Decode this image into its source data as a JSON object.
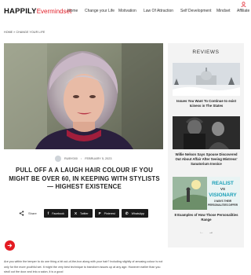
{
  "header": {
    "logo_part1": "HAPPILY",
    "logo_part2": "Evermindset",
    "nav": [
      "Home",
      "Change your Life",
      "Motivation",
      "Law Of Attraction",
      "Self Development",
      "Mindset",
      "Affiliate"
    ]
  },
  "breadcrumb": "HOME » CHANGE YOUR LIFE",
  "article": {
    "author": "RUBY000",
    "date": "FEBRUARY 5, 2023",
    "title": "PULL OFF A A LAUGH HAIR COLOUR IF YOU MIGHT BE OVER 60, IN KEEPING WITH STYLISTS — HIGHEST EXISTENCE",
    "share_label": "Share",
    "share_buttons": [
      {
        "label": "Facebook",
        "glyph": "f"
      },
      {
        "label": "Twitter",
        "glyph": "X"
      },
      {
        "label": "Pinterest",
        "glyph": "P"
      },
      {
        "label": "WhatsApp",
        "glyph": "✆"
      }
    ],
    "body": "Are you within the temper to do one thing a bit out-of-the-box along with your hair? Including slightly of amusing colour is not only for the more youthful set. It might the very best technique to transform issues up at any age. However earlier than you stroll out the door and into a salon, it is a good"
  },
  "sidebar": {
    "title": "REVIEWS",
    "items": [
      {
        "caption": "Issues You Want To Continue to exist Iciness in The States"
      },
      {
        "caption": "Willie Nelson Says Spouse Discovered Out About Affair After Seeing Mistress' Sanatorium Invoice"
      },
      {
        "caption": "8 Examples of How Those Personalities Range",
        "image_text": [
          "REALIST",
          "VS",
          "VISIONARY",
          "3 WAYS THEIR",
          "PERSONALITIES DIFFER"
        ]
      }
    ],
    "prev": "←",
    "next": "→"
  },
  "colors": {
    "brand_red": "#e2202a",
    "fab_red": "#e41b22",
    "button_dark": "#1a1a1a",
    "sidebar_bg": "#f3f3f3"
  }
}
